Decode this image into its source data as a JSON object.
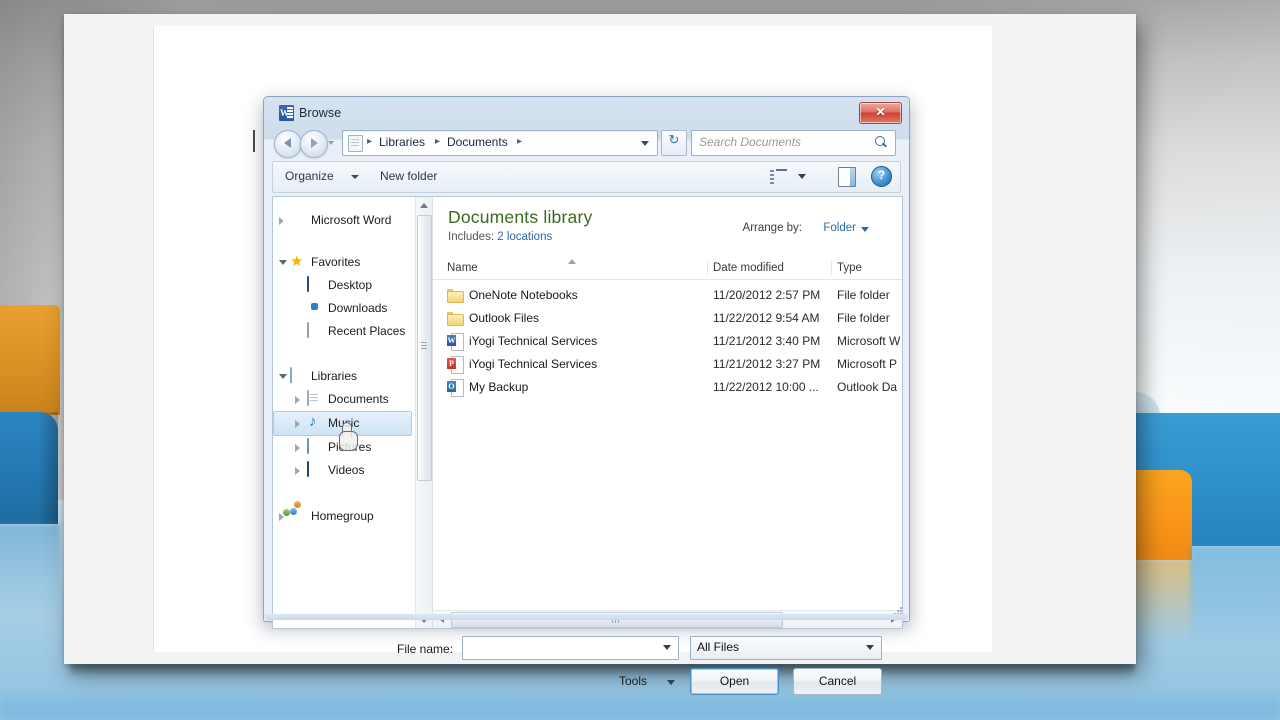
{
  "window": {
    "title": "Browse",
    "app_icon": "word-icon",
    "close_label": "✕"
  },
  "addressbar": {
    "back_icon": "back-arrow-icon",
    "forward_icon": "forward-arrow-icon",
    "history_icon": "chevron-down-icon",
    "location_icon": "library-page-icon",
    "crumbs": [
      "Libraries",
      "Documents"
    ],
    "separator": "▸",
    "dropdown_icon": "chevron-down-icon",
    "refresh_icon": "refresh-icon",
    "search_placeholder": "Search Documents",
    "search_value": "",
    "search_icon": "search-icon"
  },
  "commandbar": {
    "organize_label": "Organize",
    "organize_caret": "chevron-down-icon",
    "new_folder_label": "New folder",
    "view_icon": "view-list-icon",
    "view_caret": "chevron-down-icon",
    "preview_pane_icon": "preview-pane-icon",
    "help_icon": "help-icon"
  },
  "navigation": {
    "items": [
      {
        "label": "Microsoft Word",
        "icon": "word-icon",
        "indent": 20,
        "twisty": "collapsed",
        "selected": false
      },
      {
        "label": "Favorites",
        "icon": "star-icon",
        "indent": 20,
        "twisty": "expanded",
        "selected": false
      },
      {
        "label": "Desktop",
        "icon": "desktop-icon",
        "indent": 38,
        "twisty": "none",
        "selected": false
      },
      {
        "label": "Downloads",
        "icon": "downloads-icon",
        "indent": 38,
        "twisty": "none",
        "selected": false
      },
      {
        "label": "Recent Places",
        "icon": "recent-places-icon",
        "indent": 38,
        "twisty": "none",
        "selected": false
      },
      {
        "label": "Libraries",
        "icon": "libraries-icon",
        "indent": 20,
        "twisty": "expanded",
        "selected": false
      },
      {
        "label": "Documents",
        "icon": "documents-icon",
        "indent": 38,
        "twisty": "collapsed",
        "selected": false
      },
      {
        "label": "Music",
        "icon": "music-icon",
        "indent": 38,
        "twisty": "collapsed",
        "selected": true
      },
      {
        "label": "Pictures",
        "icon": "pictures-icon",
        "indent": 38,
        "twisty": "collapsed",
        "selected": false
      },
      {
        "label": "Videos",
        "icon": "videos-icon",
        "indent": 38,
        "twisty": "collapsed",
        "selected": false
      },
      {
        "label": "Homegroup",
        "icon": "homegroup-icon",
        "indent": 20,
        "twisty": "collapsed",
        "selected": false
      }
    ],
    "scrollbar": {
      "up_icon": "scroll-up-icon",
      "down_icon": "scroll-down-icon"
    }
  },
  "library": {
    "title": "Documents library",
    "includes_label": "Includes:",
    "includes_link": "2 locations",
    "arrange_label": "Arrange by:",
    "arrange_value": "Folder",
    "arrange_caret": "chevron-down-icon"
  },
  "filelist": {
    "columns": [
      "Name",
      "Date modified",
      "Type"
    ],
    "sort_column": "Name",
    "sort_direction": "ascending",
    "rows": [
      {
        "name": "OneNote Notebooks",
        "date": "11/20/2012 2:57 PM",
        "type": "File folder",
        "icon": "folder-icon"
      },
      {
        "name": "Outlook Files",
        "date": "11/22/2012 9:54 AM",
        "type": "File folder",
        "icon": "folder-icon"
      },
      {
        "name": "iYogi Technical Services",
        "date": "11/21/2012 3:40 PM",
        "type": "Microsoft W",
        "icon": "word-document-icon"
      },
      {
        "name": "iYogi Technical Services",
        "date": "11/21/2012 3:27 PM",
        "type": "Microsoft P",
        "icon": "powerpoint-document-icon"
      },
      {
        "name": "My Backup",
        "date": "11/22/2012 10:00 ...",
        "type": "Outlook Da",
        "icon": "outlook-data-icon"
      }
    ],
    "hscroll": {
      "left_icon": "scroll-left-icon",
      "right_icon": "scroll-right-icon"
    }
  },
  "footer": {
    "filename_label": "File name:",
    "filename_value": "",
    "filename_caret": "chevron-down-icon",
    "filter_value": "All Files",
    "filter_caret": "chevron-down-icon",
    "tools_label": "Tools",
    "tools_caret": "chevron-down-icon",
    "open_label": "Open",
    "cancel_label": "Cancel"
  },
  "colors": {
    "accent_blue": "#2a6aa8",
    "library_green": "#3a6a1e",
    "selection_blue": "#cfe4f7",
    "close_red": "#cf4030",
    "chrome_blue": "#cfdcec"
  }
}
